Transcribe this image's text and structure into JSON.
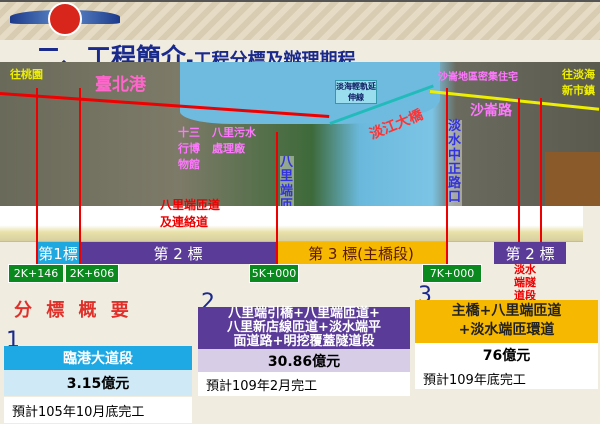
{
  "header": {
    "title_main": "二、工程簡介",
    "title_sub": "-工程分標及辦理期程"
  },
  "map": {
    "to_taoyuan": "往桃園",
    "to_danhai": "往淡海新市鎮",
    "taipei_port": "臺北港",
    "lrt": "淡海輕軌延伸線",
    "community": "沙崙地區密集住宅",
    "shalun_road": "沙崙路",
    "museum": "十三行博物館",
    "sewage": "八里污水處理廠",
    "bridge": "淡江大橋",
    "bali_ramp": "八里端匝道",
    "zhongzheng": "淡水中正路口",
    "ramp_link": "八里端匝道及連絡道"
  },
  "sections": [
    {
      "label": "第1標",
      "color": "#1fa8e0"
    },
    {
      "label": "第 2 標",
      "color": "#5b3b98"
    },
    {
      "label": "第 3 標(主橋段)",
      "color": "#f6b800"
    },
    {
      "label": "第 2 標",
      "color": "#5b3b98"
    }
  ],
  "tunnel_label": "淡水端隧道段",
  "stations": [
    "2K+146",
    "2K+606",
    "5K+000",
    "7K+000"
  ],
  "summary_title": "分 標 概 要",
  "lots": [
    {
      "number": "1",
      "name": "臨港大道段",
      "cost": "3.15億元",
      "schedule": "預計105年10月底完工"
    },
    {
      "number": "2",
      "name_line1": "八里端引橋+八里端匝道+",
      "name_line2": "八里新店線匝道+淡水端平",
      "name_line3": "面道路+明挖覆蓋隧道段",
      "cost": "30.86億元",
      "schedule": "預計109年2月完工"
    },
    {
      "number": "3",
      "name_line1": "主橋+八里端匝道",
      "name_line2": "+淡水端匝環道",
      "cost": "76億元",
      "schedule": "預計109年底完工"
    }
  ]
}
